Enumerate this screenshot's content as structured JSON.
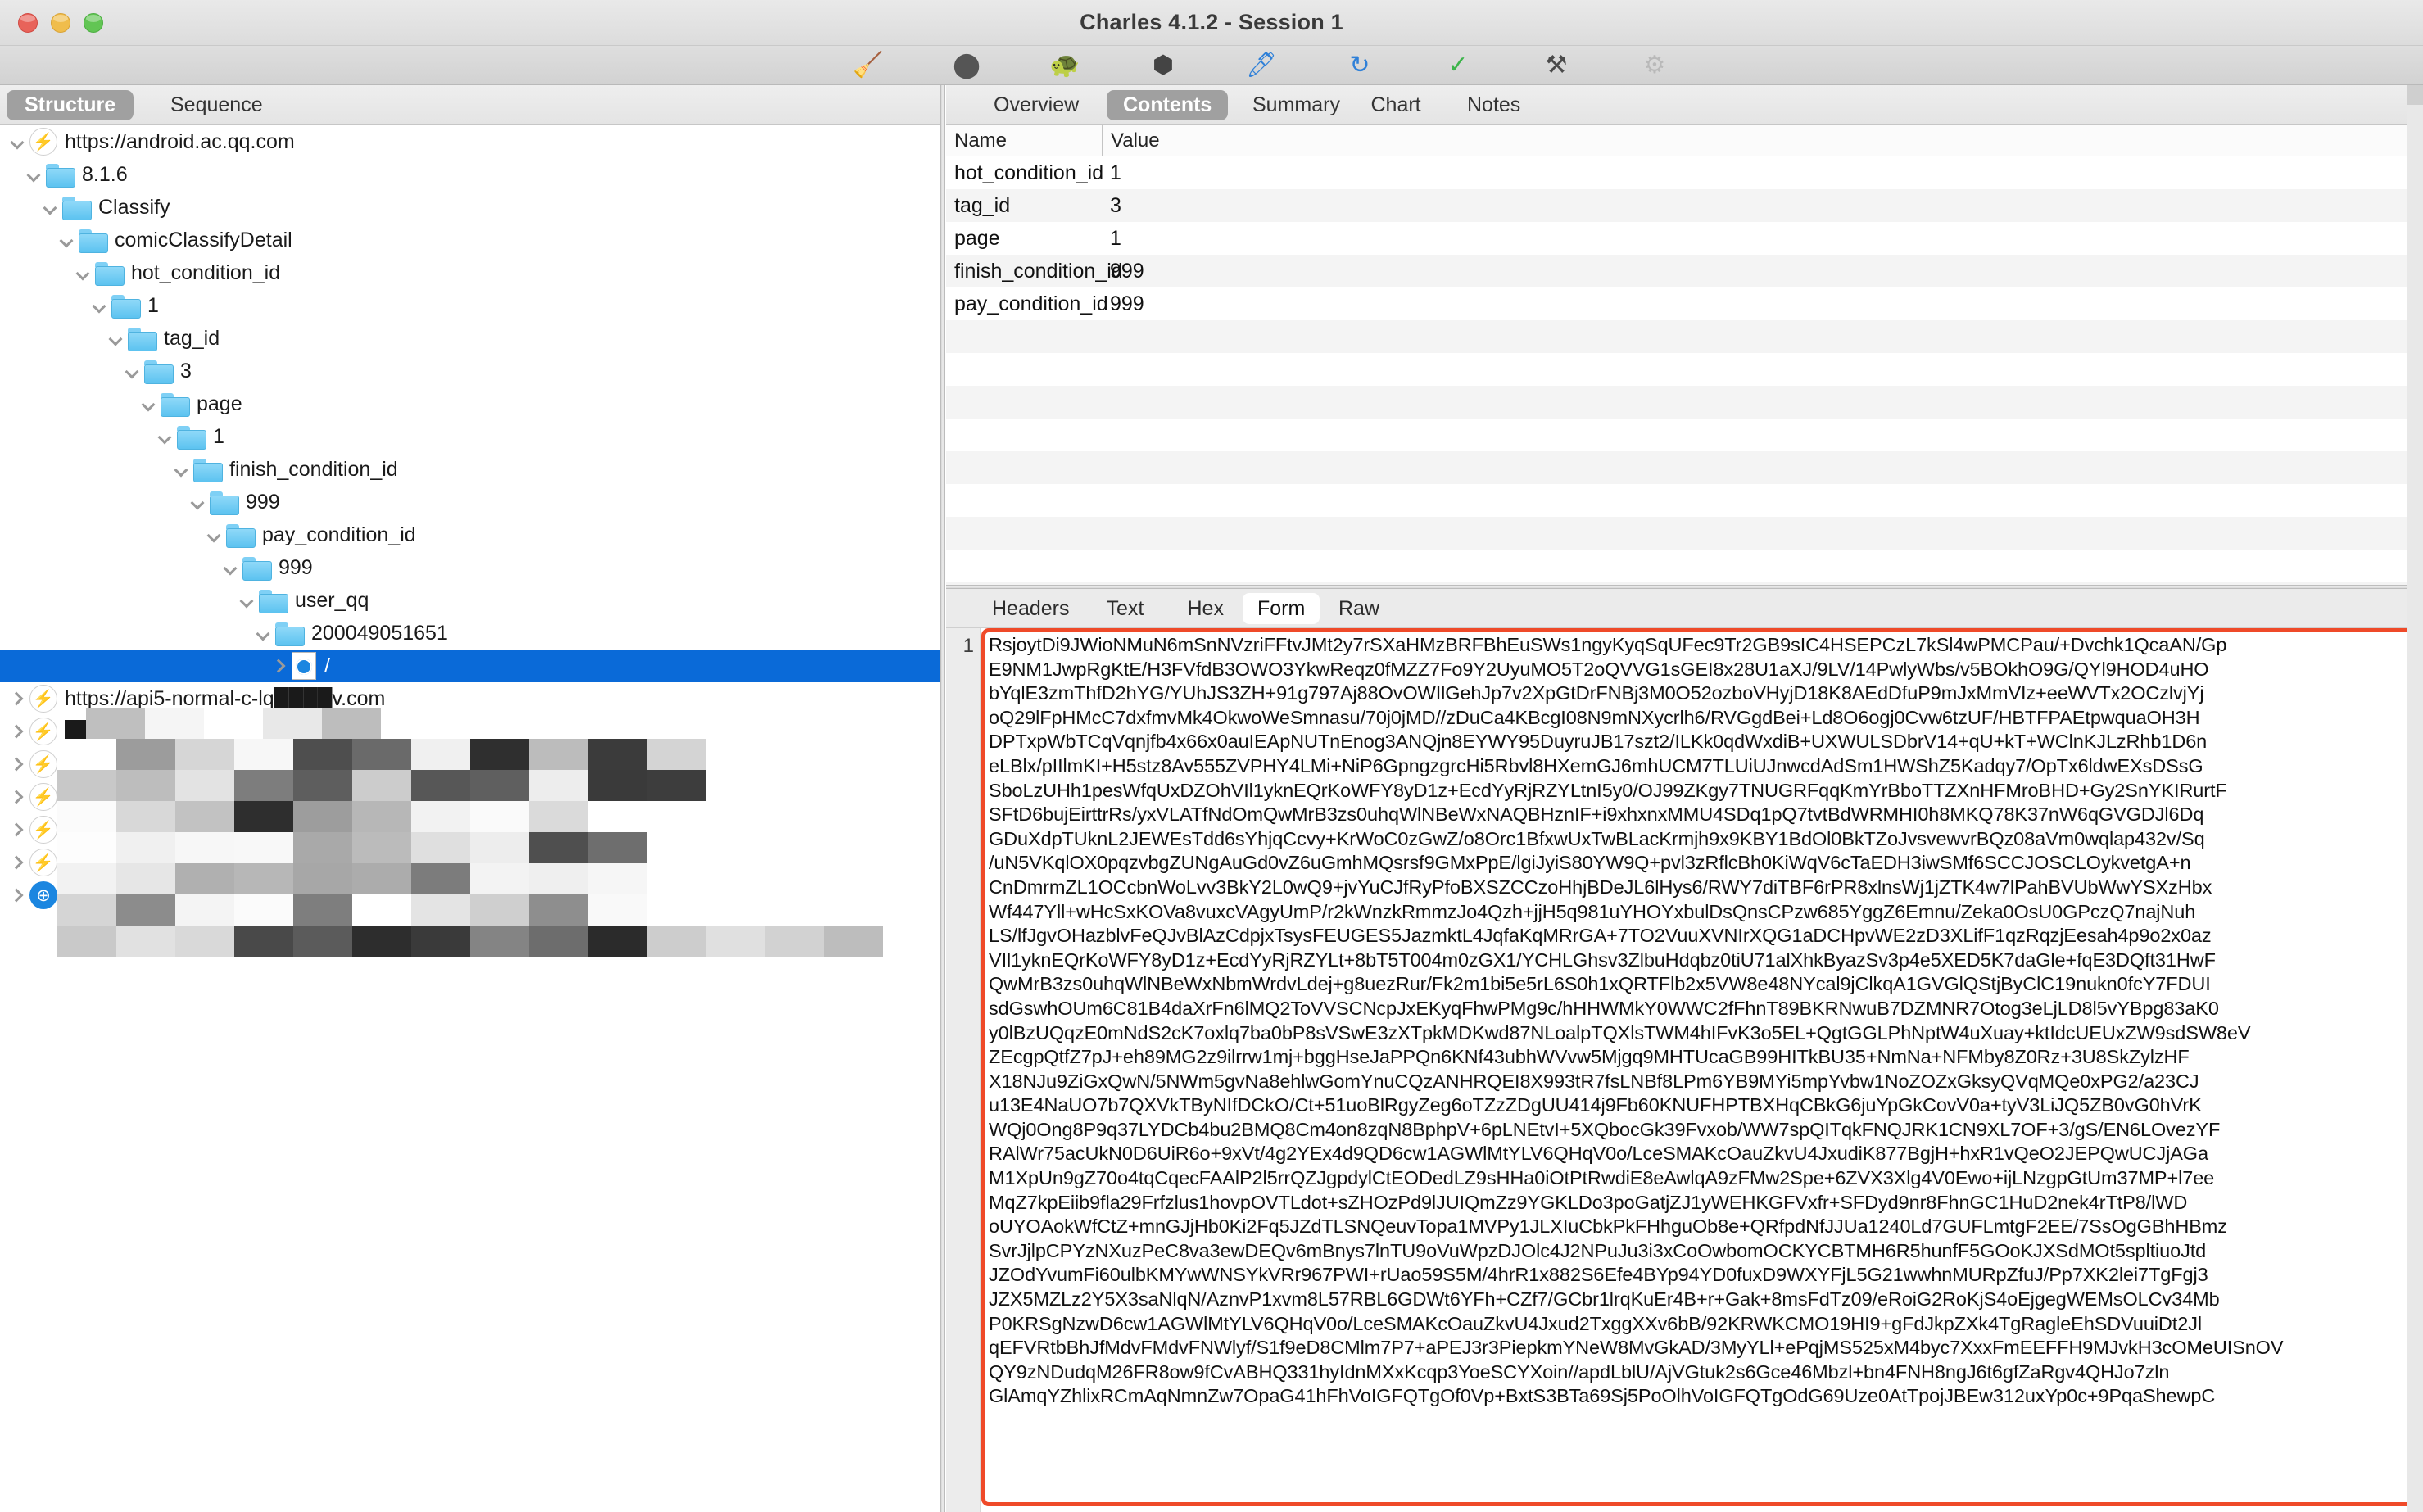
{
  "window": {
    "title": "Charles 4.1.2 - Session 1",
    "controls": {
      "close": "close",
      "minimize": "minimize",
      "maximize": "maximize"
    }
  },
  "toolbar": {
    "buttons": [
      {
        "name": "clear-session-button",
        "icon": "broom-icon",
        "glyph": "🧹"
      },
      {
        "name": "record-button",
        "icon": "record-icon",
        "glyph": "⬤"
      },
      {
        "name": "throttle-button",
        "icon": "turtle-icon",
        "glyph": "🐢"
      },
      {
        "name": "stop-button",
        "icon": "hexagon-stop-icon",
        "glyph": "⬢"
      },
      {
        "name": "compose-button",
        "icon": "pen-icon",
        "glyph": "🖊"
      },
      {
        "name": "repeat-button",
        "icon": "reload-icon",
        "glyph": "↻"
      },
      {
        "name": "validate-button",
        "icon": "checkmark-icon",
        "glyph": "✓"
      },
      {
        "name": "tools-button",
        "icon": "tools-icon",
        "glyph": "⚒"
      },
      {
        "name": "settings-button",
        "icon": "gear-icon",
        "glyph": "⚙"
      }
    ]
  },
  "left_panel": {
    "tabs": [
      {
        "label": "Structure",
        "selected": true
      },
      {
        "label": "Sequence",
        "selected": false
      }
    ],
    "tree": [
      {
        "label": "https://android.ac.qq.com",
        "depth": 0,
        "icon": "bolt-icon",
        "expanded": true,
        "selected": false,
        "redacted": false
      },
      {
        "label": "8.1.6",
        "depth": 1,
        "icon": "folder-icon",
        "expanded": true,
        "selected": false,
        "redacted": false
      },
      {
        "label": "Classify",
        "depth": 2,
        "icon": "folder-icon",
        "expanded": true,
        "selected": false,
        "redacted": false
      },
      {
        "label": "comicClassifyDetail",
        "depth": 3,
        "icon": "folder-icon",
        "expanded": true,
        "selected": false,
        "redacted": false
      },
      {
        "label": "hot_condition_id",
        "depth": 4,
        "icon": "folder-icon",
        "expanded": true,
        "selected": false,
        "redacted": false
      },
      {
        "label": "1",
        "depth": 5,
        "icon": "folder-icon",
        "expanded": true,
        "selected": false,
        "redacted": false
      },
      {
        "label": "tag_id",
        "depth": 6,
        "icon": "folder-icon",
        "expanded": true,
        "selected": false,
        "redacted": false
      },
      {
        "label": "3",
        "depth": 7,
        "icon": "folder-icon",
        "expanded": true,
        "selected": false,
        "redacted": false
      },
      {
        "label": "page",
        "depth": 8,
        "icon": "folder-icon",
        "expanded": true,
        "selected": false,
        "redacted": false
      },
      {
        "label": "1",
        "depth": 9,
        "icon": "folder-icon",
        "expanded": true,
        "selected": false,
        "redacted": false
      },
      {
        "label": "finish_condition_id",
        "depth": 10,
        "icon": "folder-icon",
        "expanded": true,
        "selected": false,
        "redacted": false
      },
      {
        "label": "999",
        "depth": 11,
        "icon": "folder-icon",
        "expanded": true,
        "selected": false,
        "redacted": false
      },
      {
        "label": "pay_condition_id",
        "depth": 12,
        "icon": "folder-icon",
        "expanded": true,
        "selected": false,
        "redacted": false
      },
      {
        "label": "999",
        "depth": 13,
        "icon": "folder-icon",
        "expanded": true,
        "selected": false,
        "redacted": false
      },
      {
        "label": "user_qq",
        "depth": 14,
        "icon": "folder-icon",
        "expanded": true,
        "selected": false,
        "redacted": false
      },
      {
        "label": "200049051651",
        "depth": 15,
        "icon": "folder-icon",
        "expanded": true,
        "selected": false,
        "redacted": false
      },
      {
        "label": "/",
        "depth": 16,
        "icon": "globe-document-icon",
        "expanded": false,
        "selected": true,
        "redacted": false
      },
      {
        "label": "https://api5-normal-c-lq████v.com",
        "depth": 0,
        "icon": "bolt-icon",
        "expanded": false,
        "selected": false,
        "redacted": true
      },
      {
        "label": "████████ame██.com",
        "depth": 0,
        "icon": "bolt-icon",
        "expanded": false,
        "selected": false,
        "redacted": true
      },
      {
        "label": "███s████sn█████n███",
        "depth": 0,
        "icon": "bolt-icon",
        "expanded": false,
        "selected": false,
        "redacted": true
      },
      {
        "label": "https█████████ing.com",
        "depth": 0,
        "icon": "bolt-icon",
        "expanded": false,
        "selected": false,
        "redacted": true
      },
      {
        "label": "https:████████████",
        "depth": 0,
        "icon": "bolt-icon",
        "expanded": false,
        "selected": false,
        "redacted": true
      },
      {
        "label": "██████████.c██",
        "depth": 0,
        "icon": "bolt-icon",
        "expanded": false,
        "selected": false,
        "redacted": true
      },
      {
        "label": "█████████████om",
        "depth": 0,
        "icon": "globe-icon",
        "expanded": false,
        "selected": false,
        "redacted": true
      }
    ]
  },
  "right_panel": {
    "tabs": [
      {
        "label": "Overview",
        "selected": false
      },
      {
        "label": "Contents",
        "selected": true
      },
      {
        "label": "Summary",
        "selected": false
      },
      {
        "label": "Chart",
        "selected": false
      },
      {
        "label": "Notes",
        "selected": false
      }
    ],
    "table": {
      "columns": [
        "Name",
        "Value"
      ],
      "rows": [
        {
          "name": "hot_condition_id",
          "value": "1"
        },
        {
          "name": "tag_id",
          "value": "3"
        },
        {
          "name": "page",
          "value": "1"
        },
        {
          "name": "finish_condition_id",
          "value": "999"
        },
        {
          "name": "pay_condition_id",
          "value": "999"
        }
      ]
    },
    "bottom_tabs": [
      {
        "label": "Headers",
        "selected": false
      },
      {
        "label": "Text",
        "selected": false
      },
      {
        "label": "Hex",
        "selected": false
      },
      {
        "label": "Form",
        "selected": true
      },
      {
        "label": "Raw",
        "selected": false
      }
    ],
    "form_body": {
      "line_number": "1",
      "highlight_color": "#ef4a29",
      "content": "RsjoytDi9JWioNMuN6mSnNVzriFFtvJMt2y7rSXaHMzBRFBhEuSWs1ngyKyqSqUFec9Tr2GB9sIC4HSEPCzL7kSl4wPMCPau/+Dvchk1QcaAN/Gp\nE9NM1JwpRgKtE/H3FVfdB3OWO3YkwReqz0fMZZ7Fo9Y2UyuMO5T2oQVVG1sGEI8x28U1aXJ/9LV/14PwlyWbs/v5BOkhO9G/QYl9HOD4uHO\nbYqlE3zmThfD2hYG/YUhJS3ZH+91g797Aj88OvOWIlGehJp7v2XpGtDrFNBj3M0O52ozboVHyjD18K8AEdDfuP9mJxMmVIz+eeWVTx2OCzlvjYj\noQ29lFpHMcC7dxfmvMk4OkwoWeSmnasu/70j0jMD//zDuCa4KBcgI08N9mNXycrlh6/RVGgdBei+Ld8O6ogj0Cvw6tzUF/HBTFPAEtpwquaOH3H\nDPTxpWbTCqVqnjfb4x66x0auIEApNUTnEnog3ANQjn8EYWY95DuyruJB17szt2/ILKk0qdWxdiB+UXWULSDbrV14+qU+kT+WClnKJLzRhb1D6n\neLBlx/pIIlmKI+H5stz8Av555ZVPHY4LMi+NiP6GpngzgrcHi5Rbvl8HXemGJ6mhUCM7TLUiUJnwcdAdSm1HWShZ5Kadqy7/OpTx6ldwEXsDSsG\nSboLzUHh1pesWfqUxDZOhVIl1yknEQrKoWFY8yD1z+EcdYyRjRZYLtnI5y0/OJ99ZKgy7TNUGRFqqKmYrBboTTZXnHFMroBHD+Gy2SnYKIRurtF\nSFtD6bujEirttrRs/yxVLATfNdOmQwMrB3zs0uhqWlNBeWxNAQBHznIF+i9xhxnxMMU4SDq1pQ7tvtBdWRMHI0h8MKQ78K37nW6qGVGDJl6Dq\nGDuXdpTUknL2JEWEsTdd6sYhjqCcvy+KrWoC0zGwZ/o8Orc1BfxwUxTwBLacKrmjh9x9KBY1BdOl0BkTZoJvsvewvrBQz08aVm0wqlap432v/Sq\n/uN5VKqlOX0pqzvbgZUNgAuGd0vZ6uGmhMQsrsf9GMxPpE/lgiJyiS80YW9Q+pvl3zRflcBh0KiWqV6cTaEDH3iwSMf6SCCJOSCLOykvetgA+n\nCnDmrmZL1OCcbnWoLvv3BkY2L0wQ9+jvYuCJfRyPfoBXSZCCzoHhjBDeJL6lHys6/RWY7diTBF6rPR8xlnsWj1jZTK4w7lPahBVUbWwYSXzHbx\nWf447Yll+wHcSxKOVa8vuxcVAgyUmP/r2kWnzkRmmzJo4Qzh+jjH5q981uYHOYxbulDsQnsCPzw685YggZ6Emnu/Zeka0OsU0GPczQ7najNuh\nLS/lfJgvOHazblvFeQJvBlAzCdpjxTsysFEUGES5JazmktL4JqfaKqMRrGA+7TO2VuuXVNIrXQG1aDCHpvWE2zD3XLifF1qzRqzjEesah4p9o2x0az\nVIl1yknEQrKoWFY8yD1z+EcdYyRjRZYLt+8bT5T004m0zGX1/YCHLGhsv3ZlbuHdqbz0tiU71alXhkByazSv3p4e5XED5K7daGle+fqE3DQft31HwF\nQwMrB3zs0uhqWlNBeWxNbmWrdvLdej+g8uezRur/Fk2m1bi5e5rL6S0h1xQRTFlb2x5VW8e48NYcal9jClkqA1GVGlQStjByClC19nukn0fcY7FDUI\nsdGswhOUm6C81B4daXrFn6lMQ2ToVVSCNcpJxEKyqFhwPMg9c/hHHWMkY0WWC2fFhnT89BKRNwuB7DZMNR7Otog3eLjLD8l5vYBpg83aK0\ny0lBzUQqzE0mNdS2cK7oxlq7ba0bP8sVSwE3zXTpkMDKwd87NLoalpTQXlsTWM4hIFvK3o5EL+QgtGGLPhNptW4uXuay+ktIdcUEUxZW9sdSW8eV\nZEcgpQtfZ7pJ+eh89MG2z9ilrrw1mj+bggHseJaPPQn6KNf43ubhWVvw5Mjgq9MHTUcaGB99HITkBU35+NmNa+NFMby8Z0Rz+3U8SkZylzHF\nX18NJu9ZiGxQwN/5NWm5gvNa8ehlwGomYnuCQzANHRQEI8X993tR7fsLNBf8LPm6YB9MYi5mpYvbw1NoZOZxGksyQVqMQe0xPG2/a23CJ\nu13E4NaUO7b7QXVkTByNIfDCkO/Ct+51uoBlRgyZeg6oTZzZDgUU414j9Fb60KNUFHPTBXHqCBkG6juYpGkCovV0a+tyV3LiJQ5ZB0vG0hVrK\nWQj0Ong8P9q37LYDCb4bu2BMQ8Cm4on8zqN8BphpV+6pLNEtvI+5XQbocGk39Fvxob/WW7spQITqkFNQJRK1CN9XL7OF+3/gS/EN6LOvezYF\nRAlWr75acUkN0D6UiR6o+9xVt/4g2YEx4d9QD6cw1AGWlMtYLV6QHqV0o/LceSMAKcOauZkvU4JxudiK877BgjH+hxR1vQeO2JEPQwUCJjAGa\nM1XpUn9gZ70o4tqCqecFAAlP2l5rrQZJgpdylCtEODedLZ9sHHa0iOtPtRwdiE8eAwlqA9zFMw2Spe+6ZVX3Xlg4V0Ewo+ijLNzgpGtUm37MP+l7ee\nMqZ7kpEiib9fla29Frfzlus1hovpOVTLdot+sZHOzPd9lJUIQmZz9YGKLDo3poGatjZJ1yWEHKGFVxfr+SFDyd9nr8FhnGC1HuD2nek4rTtP8/lWD\noUYOAokWfCtZ+mnGJjHb0Ki2Fq5JZdTLSNQeuvTopa1MVPy1JLXIuCbkPkFHhguOb8e+QRfpdNfJJUa1240Ld7GUFLmtgF2EE/7SsOgGBhHBmz\nSvrJjlpCPYzNXuzPeC8va3ewDEQv6mBnys7lnTU9oVuWpzDJOlc4J2NPuJu3i3xCoOwbomOCKYCBTMH6R5hunfF5GOoKJXSdMOt5spltiuoJtd\nJZOdYvumFi60ulbKMYwWNSYkVRr967PWI+rUao59S5M/4hrR1x882S6Efe4BYp94YD0fuxD9WXYFjL5G21wwhnMURpZfuJ/Pp7XK2lei7TgFgj3\nJZX5MZLz2Y5X3saNlqN/AznvP1xvm8L57RBL6GDWt6YFh+CZf7/GCbr1lrqKuEr4B+r+Gak+8msFdTz09/eRoiG2RoKjS4oEjgegWEMsOLCv34Mb\nP0KRSgNzwD6cw1AGWlMtYLV6QHqV0o/LceSMAKcOauZkvU4Jxud2TxggXXv6bB/92KRWKCMO19HI9+gFdJkpZXk4TgRagleEhSDVuuiDt2Jl\nqEFVRtbBhJfMdvFMdvFNWlyf/S1f9eD8CMlm7P7+aPEJ3r3PiepkmYNeW8MvGkAD/3MyYLl+ePqjMS525xM4byc7XxxFmEEFFH9MJvkH3cOMeUISnOV\nQY9zNDudqM26FR8ow9fCvABHQ331hyIdnMXxKcqp3YoeSCYXoin//apdLblU/AjVGtuk2s6Gce46Mbzl+bn4FNH8ngJ6t6gfZaRgv4QHJo7zln\nGlAmqYZhlixRCmAqNmnZw7OpaG41hFhVoIGFQTgOf0Vp+BxtS3BTa69Sj5PoOlhVoIGFQTgOdG69Uze0AtTpojJBEw312uxYp0c+9PqaShewpC"
    }
  }
}
